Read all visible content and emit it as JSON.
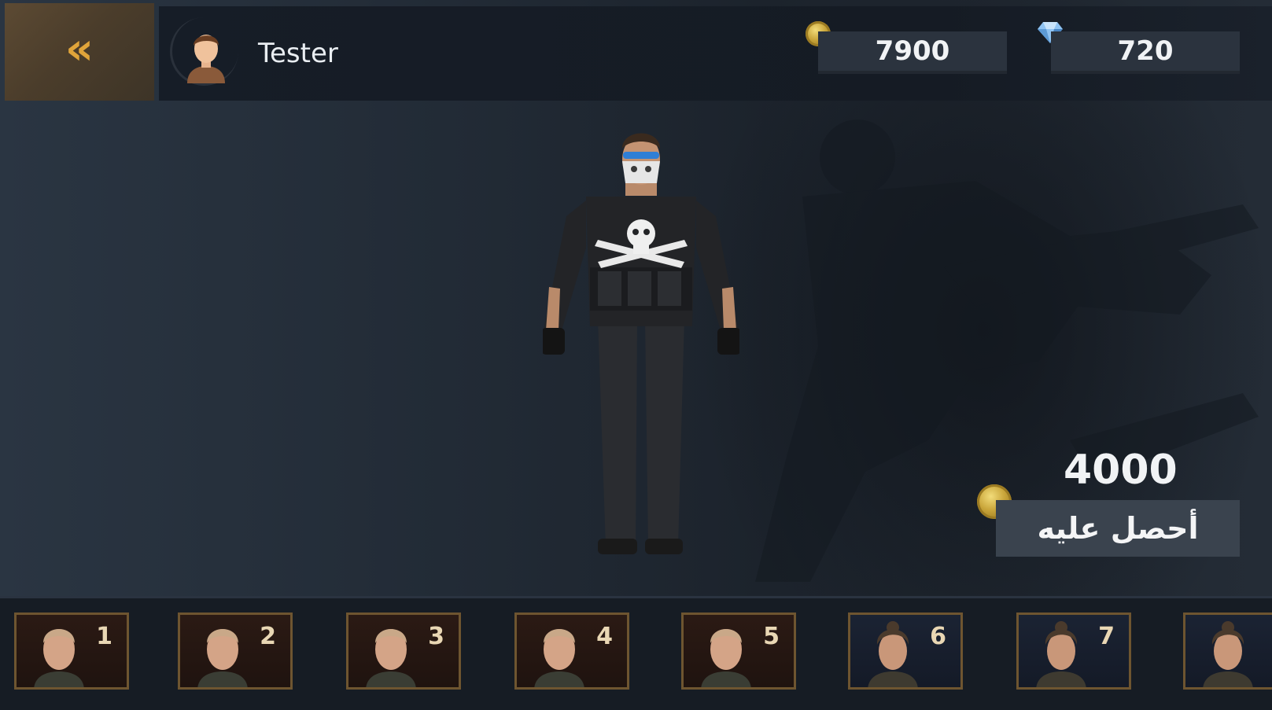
{
  "header": {
    "back_icon": "double-chevron-left-icon",
    "player_name": "Tester",
    "gold": "7900",
    "gems": "720"
  },
  "shop": {
    "price": "4000",
    "buy_label": "أحصل عليه"
  },
  "roster": {
    "skins": [
      {
        "number": "1",
        "gender": "male"
      },
      {
        "number": "2",
        "gender": "male"
      },
      {
        "number": "3",
        "gender": "male"
      },
      {
        "number": "4",
        "gender": "male"
      },
      {
        "number": "5",
        "gender": "male"
      },
      {
        "number": "6",
        "gender": "female"
      },
      {
        "number": "7",
        "gender": "female"
      },
      {
        "number": "",
        "gender": "female"
      }
    ]
  },
  "colors": {
    "accent_gold": "#e0a43a",
    "slot_border": "#6e5530"
  }
}
